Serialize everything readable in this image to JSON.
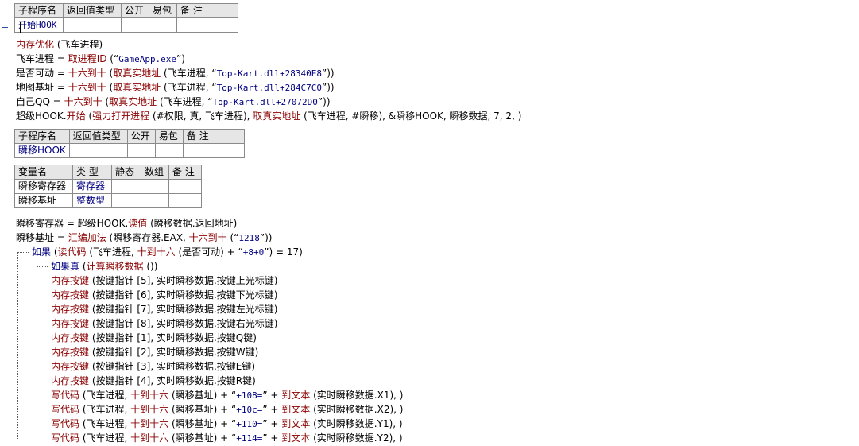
{
  "sub1": {
    "headers": [
      "子程序名",
      "返回值类型",
      "公开",
      "易包",
      "备 注"
    ],
    "name": "开始HOOK"
  },
  "lines1": {
    "l1": {
      "a": "内存优化",
      "b": " (飞车进程)"
    },
    "l2": {
      "a": "飞车进程",
      "b": " = ",
      "c": "取进程ID",
      "d": " (“",
      "e": "GameApp.exe",
      "f": "”)"
    },
    "l3": {
      "a": "是否可动",
      "b": " = ",
      "c": "十六到十",
      "d": " (",
      "e": "取真实地址",
      "f": " (飞车进程, “",
      "g": "Top-Kart.dll+28340E8",
      "h": "”))"
    },
    "l4": {
      "a": "地图基址",
      "b": " = ",
      "c": "十六到十",
      "d": " (",
      "e": "取真实地址",
      "f": " (飞车进程, “",
      "g": "Top-Kart.dll+284C7C0",
      "h": "”))"
    },
    "l5": {
      "a": "自己QQ",
      "b": " = ",
      "c": "十六到十",
      "d": " (",
      "e": "取真实地址",
      "f": " (飞车进程, “",
      "g": "Top-Kart.dll+27072D0",
      "h": "”))"
    },
    "l6": {
      "a": "超级HOOK.",
      "b": "开始",
      "c": " (",
      "d": "强力打开进程",
      "e": " (#权限, 真, 飞车进程), ",
      "f": "取真实地址",
      "g": " (飞车进程, #瞬移), &瞬移HOOK, 瞬移数据, 7, 2, )"
    }
  },
  "sub2": {
    "headers": [
      "子程序名",
      "返回值类型",
      "公开",
      "易包",
      "备 注"
    ],
    "name": "瞬移HOOK"
  },
  "vars": {
    "headers": [
      "变量名",
      "类 型",
      "静态",
      "数组",
      "备 注"
    ],
    "rows": [
      {
        "name": "瞬移寄存器",
        "type": "寄存器"
      },
      {
        "name": "瞬移基址",
        "type": "整数型"
      }
    ]
  },
  "lines2": {
    "l1": {
      "a": "瞬移寄存器 = 超级HOOK.",
      "b": "读值",
      "c": " (瞬移数据.返回地址)"
    },
    "l2": {
      "a": "瞬移基址",
      "b": " = ",
      "c": "汇编加法",
      "d": " (瞬移寄存器.EAX, ",
      "e": "十六到十",
      "f": " (“",
      "g": "1218",
      "h": "”))"
    },
    "if1": {
      "a": "如果",
      "b": " (",
      "c": "读代码",
      "d": " (飞车进程, ",
      "e": "十到十六",
      "f": " (是否可动) + “",
      "g": "+8+0",
      "h": "”) = 17)"
    },
    "if2": {
      "a": "如果真",
      "b": " (",
      "c": "计算瞬移数据",
      "d": " ())"
    }
  },
  "mem_lines": [
    {
      "fn": "内存按键",
      "rest": " (按键指针 [5], 实时瞬移数据.按键上光标键)"
    },
    {
      "fn": "内存按键",
      "rest": " (按键指针 [6], 实时瞬移数据.按键下光标键)"
    },
    {
      "fn": "内存按键",
      "rest": " (按键指针 [7], 实时瞬移数据.按键左光标键)"
    },
    {
      "fn": "内存按键",
      "rest": " (按键指针 [8], 实时瞬移数据.按键右光标键)"
    },
    {
      "fn": "内存按键",
      "rest": " (按键指针 [1], 实时瞬移数据.按键Q键)"
    },
    {
      "fn": "内存按键",
      "rest": " (按键指针 [2], 实时瞬移数据.按键W键)"
    },
    {
      "fn": "内存按键",
      "rest": " (按键指针 [3], 实时瞬移数据.按键E键)"
    },
    {
      "fn": "内存按键",
      "rest": " (按键指针 [4], 实时瞬移数据.按键R键)"
    }
  ],
  "write_lines": [
    {
      "fn": "写代码",
      "p1": " (飞车进程, ",
      "fn2": "十到十六",
      "p2": " (瞬移基址) + “",
      "s": "+108=",
      "p3": "” + ",
      "fn3": "到文本",
      "p4": " (实时瞬移数据.X1), )"
    },
    {
      "fn": "写代码",
      "p1": " (飞车进程, ",
      "fn2": "十到十六",
      "p2": " (瞬移基址) + “",
      "s": "+10c=",
      "p3": "” + ",
      "fn3": "到文本",
      "p4": " (实时瞬移数据.X2), )"
    },
    {
      "fn": "写代码",
      "p1": " (飞车进程, ",
      "fn2": "十到十六",
      "p2": " (瞬移基址) + “",
      "s": "+110=",
      "p3": "” + ",
      "fn3": "到文本",
      "p4": " (实时瞬移数据.Y1), )"
    },
    {
      "fn": "写代码",
      "p1": " (飞车进程, ",
      "fn2": "十到十六",
      "p2": " (瞬移基址) + “",
      "s": "+114=",
      "p3": "” + ",
      "fn3": "到文本",
      "p4": " (实时瞬移数据.Y2), )"
    }
  ]
}
